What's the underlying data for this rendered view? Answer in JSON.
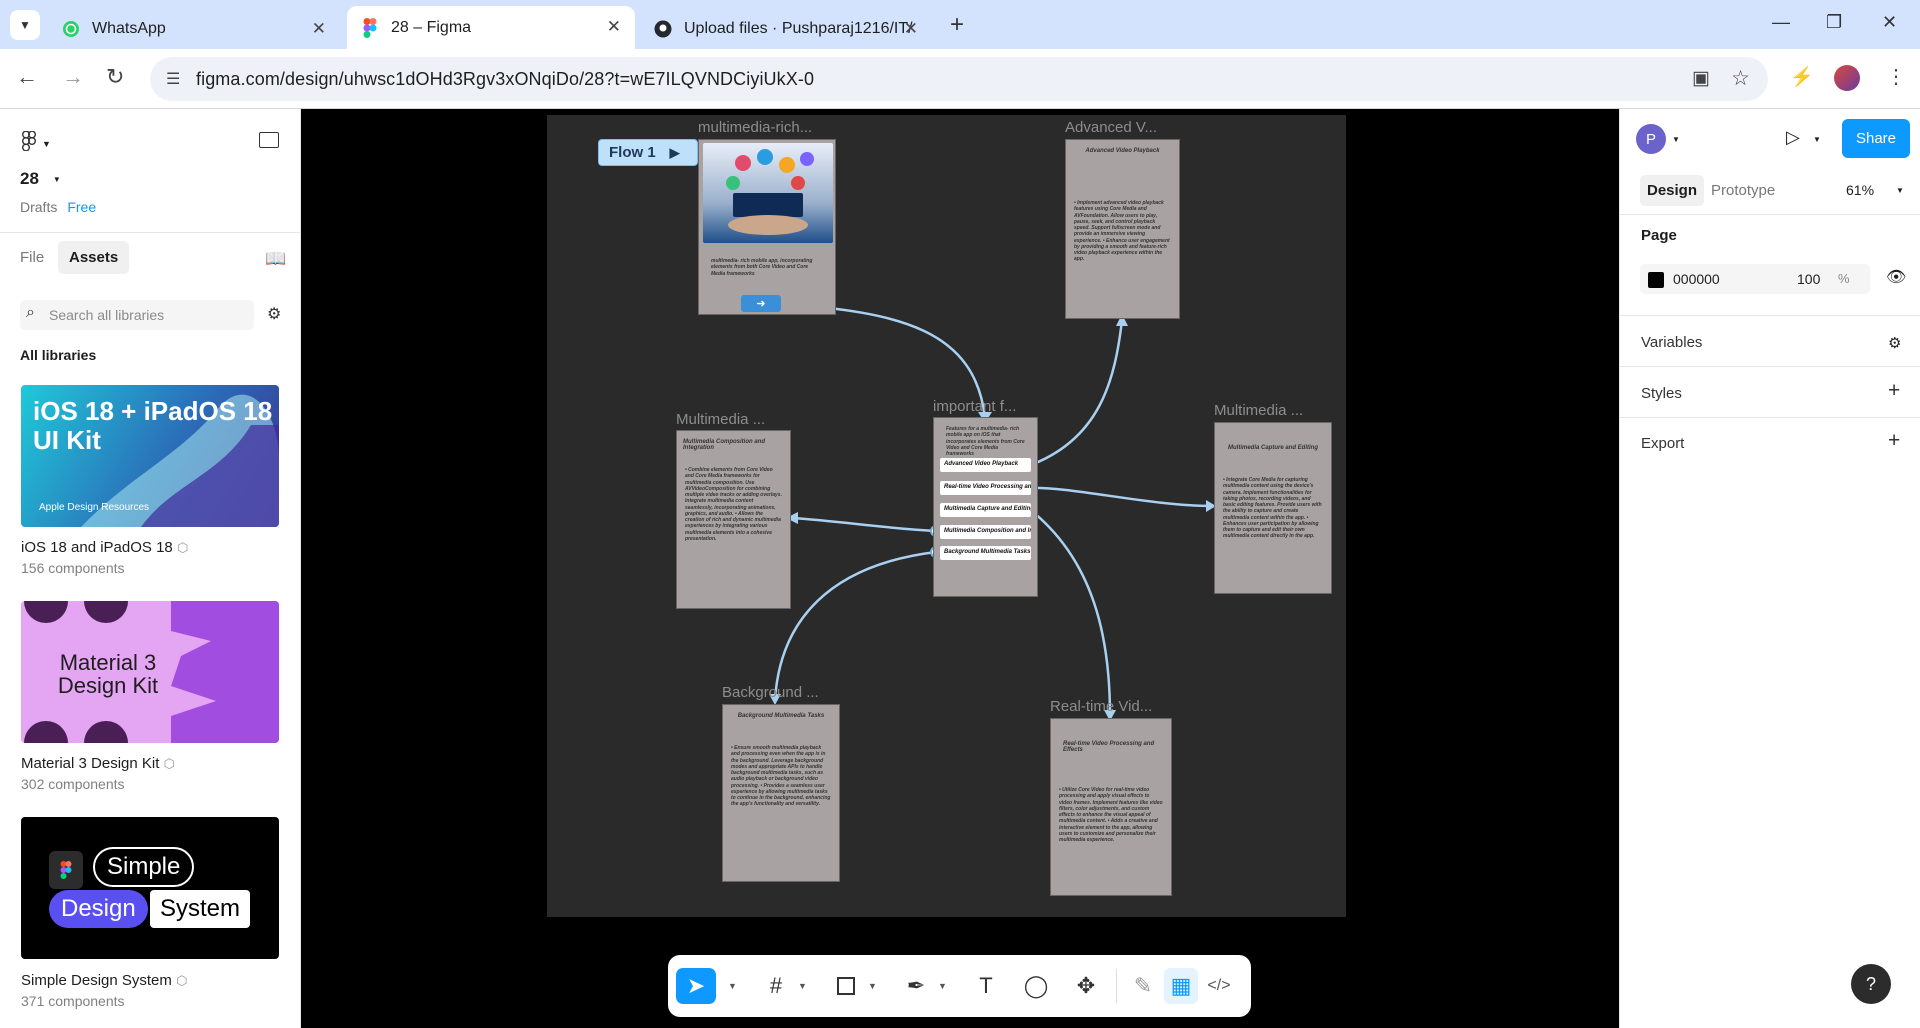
{
  "browser": {
    "tabs": [
      {
        "title": "WhatsApp",
        "icon": "whatsapp-icon"
      },
      {
        "title": "28 – Figma",
        "icon": "figma-icon"
      },
      {
        "title": "Upload files · Pushparaj1216/IT/",
        "icon": "github-icon"
      }
    ],
    "url": "figma.com/design/uhwsc1dOHd3Rgv3xONqiDo/28?t=wE7ILQVNDCiyiUkX-0"
  },
  "figma": {
    "file_name": "28",
    "drafts": "Drafts",
    "plan": "Free",
    "left_tabs": [
      "File",
      "Assets"
    ],
    "search_placeholder": "Search all libraries",
    "all_libraries": "All libraries",
    "libraries": [
      {
        "card_title": "iOS 18 + iPadOS 18 UI Kit",
        "card_sub": "Apple Design Resources",
        "name": "iOS 18 and iPadOS 18",
        "count": "156 components"
      },
      {
        "card_title": "Material 3 Design Kit",
        "name": "Material 3 Design Kit",
        "count": "302 components"
      },
      {
        "card_words": [
          "Simple",
          "Design",
          "System"
        ],
        "name": "Simple Design System",
        "count": "371 components"
      }
    ],
    "right": {
      "avatar": "P",
      "share": "Share",
      "tabs": [
        "Design",
        "Prototype"
      ],
      "zoom": "61%",
      "page_label": "Page",
      "page_color": "000000",
      "page_opacity": "100",
      "percent": "%",
      "sections": [
        "Variables",
        "Styles",
        "Export"
      ]
    },
    "help": "?"
  },
  "canvas": {
    "flow_label": "Flow 1",
    "frames": [
      {
        "title": "multimedia-rich...",
        "body": "multimedia- rich mobile app, incorporating elements from both Core Video and Core Media frameworks"
      },
      {
        "title": "Advanced V...",
        "heading": "Advanced Video Playback",
        "body": "• Implement advanced video playback features using Core Media and AVFoundation. Allow users to play, pause, seek, and control playback speed. Support fullscreen mode and provide an immersive viewing experience. • Enhance user engagement by providing a smooth and feature-rich video playback experience within the app."
      },
      {
        "title": "Multimedia ...",
        "heading": "Multimedia Composition and Integration",
        "body": "• Combine elements from Core Video and Core Media frameworks for multimedia composition. Use AVVideoComposition for combining multiple video tracks or adding overlays. Integrate multimedia content seamlessly, incorporating animations, graphics, and audio. • Allows the creation of rich and dynamic multimedia experiences by integrating various multimedia elements into a cohesive presentation."
      },
      {
        "title": "important f...",
        "heading": "Features for a multimedia- rich mobile app on iOS that incorporates elements from Core Video and Core Media frameworks",
        "items": [
          "Advanced Video Playback",
          "Real-time Video Processing and Effects",
          "Multimedia Capture and Editing",
          "Multimedia Composition and Integration",
          "Background Multimedia Tasks"
        ]
      },
      {
        "title": "Multimedia ...",
        "heading": "Multimedia Capture and Editing",
        "body": "• Integrate Core Media for capturing multimedia content using the device's camera. Implement functionalities for taking photos, recording videos, and basic editing features. Provide users with the ability to capture and create multimedia content within the app. • Enhances user participation by allowing them to capture and edit their own multimedia content directly in the app."
      },
      {
        "title": "Background ...",
        "heading": "Background Multimedia Tasks",
        "body": "• Ensure smooth multimedia playback and processing even when the app is in the background. Leverage background modes and appropriate APIs to handle background multimedia tasks, such as audio playback or background video processing. • Provides a seamless user experience by allowing multimedia tasks to continue in the background, enhancing the app's functionality and versatility."
      },
      {
        "title": "Real-time Vid...",
        "heading": "Real-time Video Processing and Effects",
        "body": "• Utilize Core Video for real-time video processing and apply visual effects to video frames. Implement features like video filters, color adjustments, and custom effects to enhance the visual appeal of multimedia content. • Adds a creative and interactive element to the app, allowing users to customize and personalize their multimedia experience."
      }
    ]
  }
}
